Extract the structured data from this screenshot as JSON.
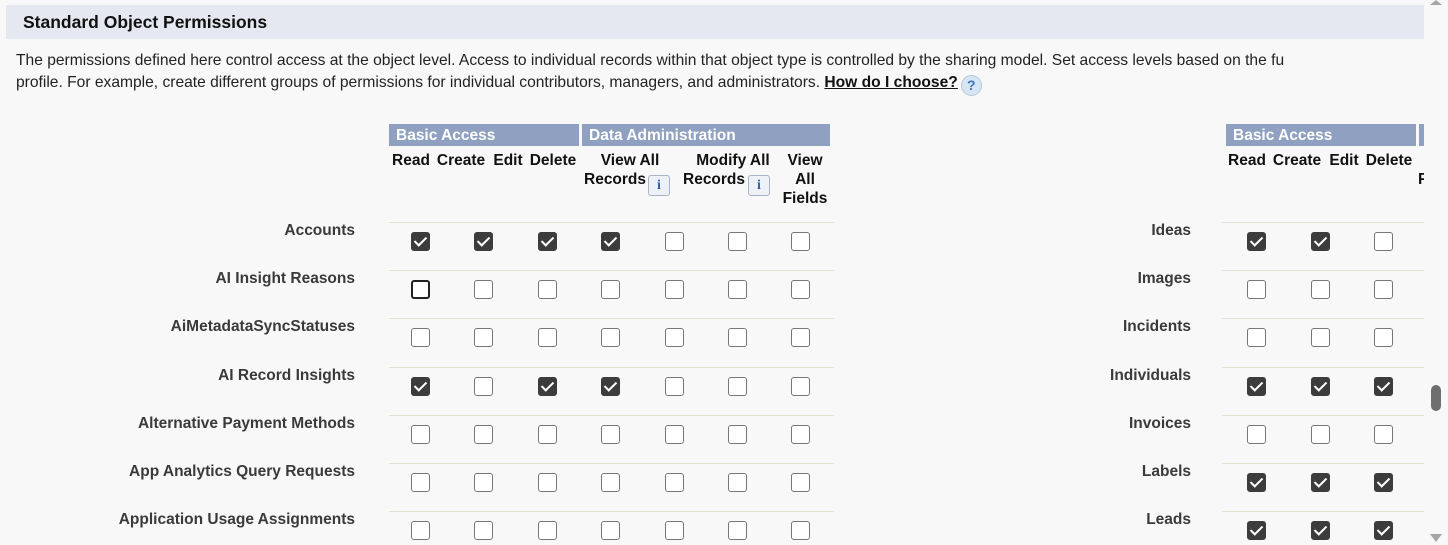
{
  "section": {
    "title": "Standard Object Permissions",
    "intro_line1": "The permissions defined here control access at the object level. Access to individual records within that object type is controlled by the sharing model. Set access levels based on the fu",
    "intro_line2": "profile. For example, create different groups of permissions for individual contributors, managers, and administrators.",
    "help_link": "How do I choose?",
    "help_icon": "?"
  },
  "left_table": {
    "groups": {
      "basic_access": "Basic Access",
      "data_administration": "Data Administration"
    },
    "columns": {
      "read": "Read",
      "create": "Create",
      "edit": "Edit",
      "delete": "Delete",
      "view_all_records": [
        "View All",
        "Records"
      ],
      "modify_all_records": [
        "Modify All",
        "Records"
      ],
      "view_all_fields": [
        "View",
        "All",
        "Fields"
      ]
    },
    "info_icon": "i",
    "rows": [
      {
        "name": "Accounts",
        "checks": [
          true,
          true,
          true,
          true,
          false,
          false,
          false
        ]
      },
      {
        "name": "AI Insight Reasons",
        "checks": [
          false,
          false,
          false,
          false,
          false,
          false,
          false
        ]
      },
      {
        "name": "AiMetadataSyncStatuses",
        "checks": [
          false,
          false,
          false,
          false,
          false,
          false,
          false
        ]
      },
      {
        "name": "AI Record Insights",
        "checks": [
          true,
          false,
          true,
          true,
          false,
          false,
          false
        ]
      },
      {
        "name": "Alternative Payment Methods",
        "checks": [
          false,
          false,
          false,
          false,
          false,
          false,
          false
        ]
      },
      {
        "name": "App Analytics Query Requests",
        "checks": [
          false,
          false,
          false,
          false,
          false,
          false,
          false
        ]
      },
      {
        "name": "Application Usage Assignments",
        "checks": [
          false,
          false,
          false,
          false,
          false,
          false,
          false
        ]
      }
    ]
  },
  "right_table": {
    "groups": {
      "basic_access": "Basic Access"
    },
    "columns": {
      "read": "Read",
      "create": "Create",
      "edit": "Edit",
      "delete": "Delete",
      "partial": "F"
    },
    "rows": [
      {
        "name": "Ideas",
        "checks": [
          true,
          true,
          false
        ]
      },
      {
        "name": "Images",
        "checks": [
          false,
          false,
          false
        ]
      },
      {
        "name": "Incidents",
        "checks": [
          false,
          false,
          false
        ]
      },
      {
        "name": "Individuals",
        "checks": [
          true,
          true,
          true
        ]
      },
      {
        "name": "Invoices",
        "checks": [
          false,
          false,
          false
        ]
      },
      {
        "name": "Labels",
        "checks": [
          true,
          true,
          true
        ]
      },
      {
        "name": "Leads",
        "checks": [
          true,
          true,
          true
        ]
      }
    ]
  },
  "scrollbar": {
    "position_percent": 73
  }
}
